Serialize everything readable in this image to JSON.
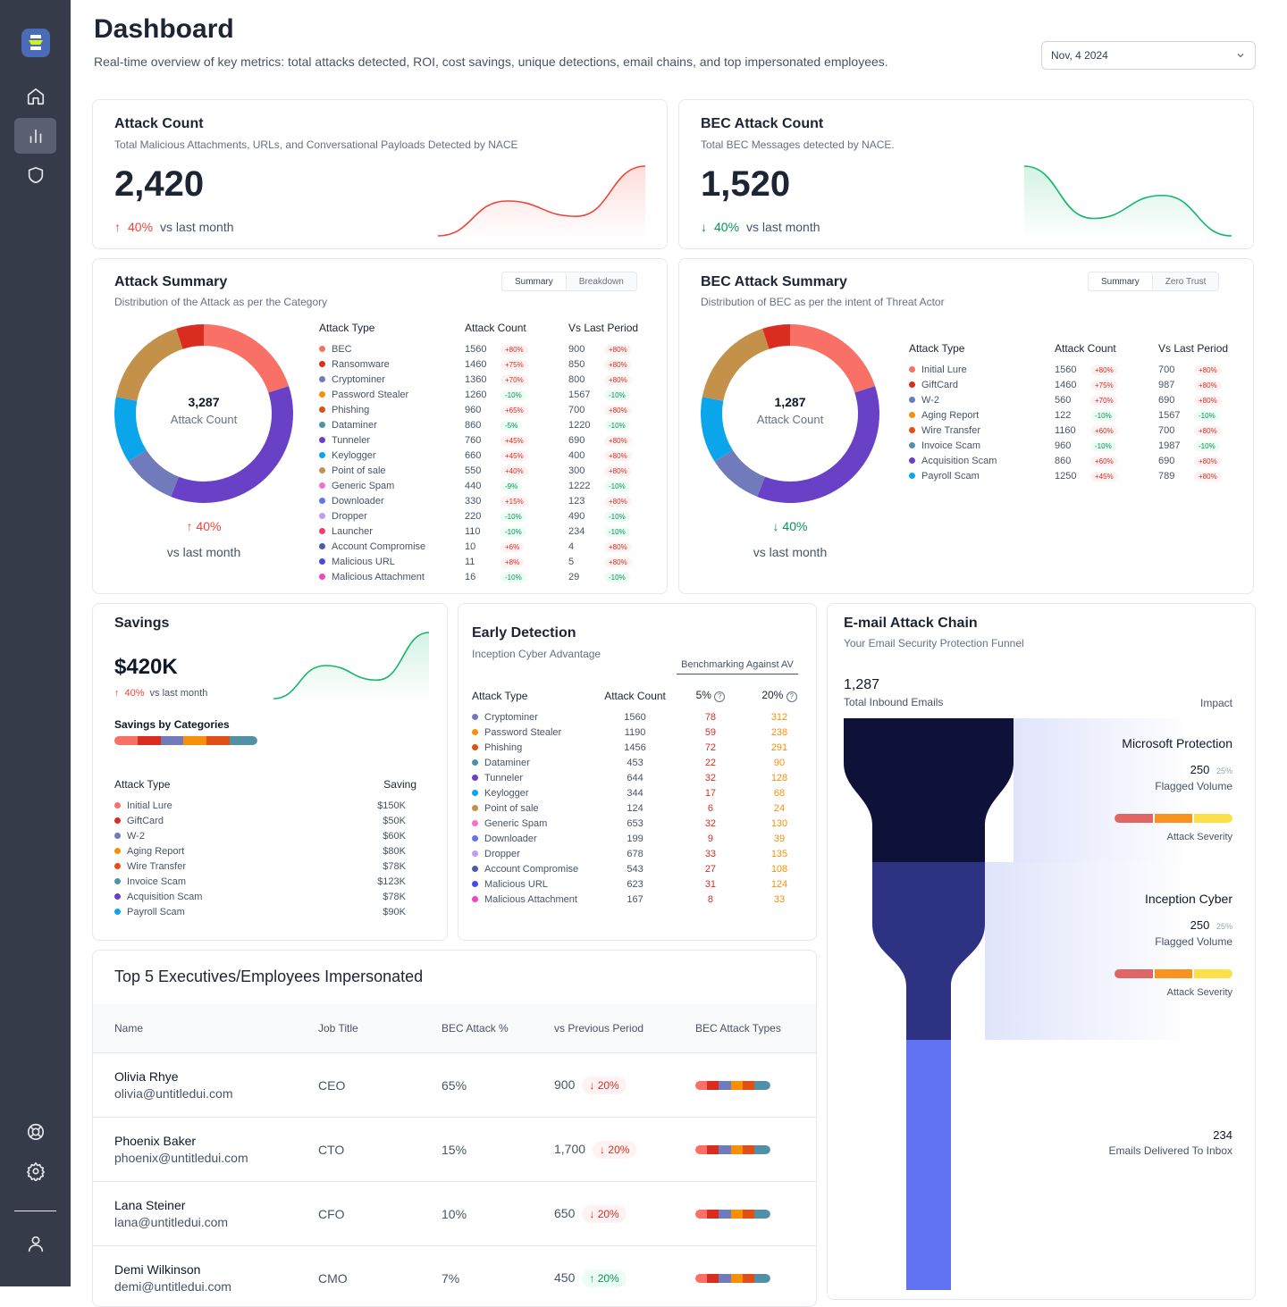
{
  "sidebar": {
    "icons": [
      "home-icon",
      "bar-chart-icon",
      "shield-icon",
      "lifebuoy-icon",
      "settings-icon",
      "user-icon"
    ],
    "active": "bar-chart-icon"
  },
  "header": {
    "title": "Dashboard",
    "subtitle": "Real-time overview of key metrics: total attacks detected, ROI, cost savings, unique detections, email chains, and top impersonated employees.",
    "date": "Nov, 4 2024"
  },
  "attack_count": {
    "title": "Attack Count",
    "subtitle": "Total Malicious Attachments, URLs, and Conversational Payloads Detected by NACE",
    "value": "2,420",
    "trend": "40%",
    "trend_dir": "up",
    "trend_label": "vs last month",
    "spark": [
      0,
      50,
      28,
      100
    ],
    "color": "#f04438"
  },
  "bec_count": {
    "title": "BEC Attack Count",
    "subtitle": "Total BEC Messages detected by NACE.",
    "value": "1,520",
    "trend": "40%",
    "trend_dir": "down",
    "trend_label": "vs last month",
    "spark": [
      100,
      25,
      58,
      0
    ],
    "color": "#12b76a"
  },
  "attack_summary": {
    "title": "Attack Summary",
    "subtitle": "Distribution of the Attack as per the Category",
    "tabs": [
      "Summary",
      "Breakdown"
    ],
    "center_value": "3,287",
    "center_label": "Attack Count",
    "trend": "40%",
    "trend_label": "vs last month",
    "columns": [
      "Attack Type",
      "Attack Count",
      "Vs Last Period"
    ],
    "rows": [
      {
        "name": "BEC",
        "color": "#f97066",
        "count": "1560",
        "cc": "+80%",
        "prev": "900",
        "pc": "+80%"
      },
      {
        "name": "Ransomware",
        "color": "#d92d20",
        "count": "1460",
        "cc": "+75%",
        "prev": "850",
        "pc": "+80%"
      },
      {
        "name": "Cryptominer",
        "color": "#717bbc",
        "count": "1360",
        "cc": "+70%",
        "prev": "800",
        "pc": "+80%"
      },
      {
        "name": "Password Stealer",
        "color": "#f79009",
        "count": "1260",
        "cc": "-10%",
        "prev": "1567",
        "pc": "-10%"
      },
      {
        "name": "Phishing",
        "color": "#e04f16",
        "count": "960",
        "cc": "+65%",
        "prev": "700",
        "pc": "+80%"
      },
      {
        "name": "Dataminer",
        "color": "#5290a8",
        "count": "860",
        "cc": "-5%",
        "prev": "1220",
        "pc": "-10%"
      },
      {
        "name": "Tunneler",
        "color": "#6941c6",
        "count": "760",
        "cc": "+45%",
        "prev": "690",
        "pc": "+80%"
      },
      {
        "name": "Keylogger",
        "color": "#0ba5ec",
        "count": "660",
        "cc": "+45%",
        "prev": "400",
        "pc": "+80%"
      },
      {
        "name": "Point of sale",
        "color": "#c4914b",
        "count": "550",
        "cc": "+40%",
        "prev": "300",
        "pc": "+80%"
      },
      {
        "name": "Generic Spam",
        "color": "#f670c7",
        "count": "440",
        "cc": "-9%",
        "prev": "1222",
        "pc": "-10%"
      },
      {
        "name": "Downloader",
        "color": "#6172f3",
        "count": "330",
        "cc": "+15%",
        "prev": "123",
        "pc": "+80%"
      },
      {
        "name": "Dropper",
        "color": "#c09cf8",
        "count": "220",
        "cc": "-10%",
        "prev": "490",
        "pc": "-10%"
      },
      {
        "name": "Launcher",
        "color": "#f63d68",
        "count": "110",
        "cc": "-10%",
        "prev": "234",
        "pc": "-10%"
      },
      {
        "name": "Account Compromise",
        "color": "#4e5ba6",
        "count": "10",
        "cc": "+6%",
        "prev": "4",
        "pc": "+80%"
      },
      {
        "name": "Malicious URL",
        "color": "#444ce7",
        "count": "11",
        "cc": "+8%",
        "prev": "5",
        "pc": "+80%"
      },
      {
        "name": "Malicious Attachment",
        "color": "#ee46bc",
        "count": "16",
        "cc": "-10%",
        "prev": "29",
        "pc": "-10%"
      }
    ],
    "donut": [
      {
        "color": "#f97066",
        "value": 20
      },
      {
        "color": "#6941c6",
        "value": 36
      },
      {
        "color": "#717bbc",
        "value": 10
      },
      {
        "color": "#0ba5ec",
        "value": 12
      },
      {
        "color": "#c4914b",
        "value": 17
      },
      {
        "color": "#d92d20",
        "value": 5
      }
    ]
  },
  "bec_summary": {
    "title": "BEC Attack Summary",
    "subtitle": "Distribution of BEC as per the intent of Threat Actor",
    "tabs": [
      "Summary",
      "Zero Trust"
    ],
    "center_value": "1,287",
    "center_label": "Attack Count",
    "trend": "40%",
    "trend_label": "vs last month",
    "columns": [
      "Attack Type",
      "Attack Count",
      "Vs Last Period"
    ],
    "rows": [
      {
        "name": "Initial Lure",
        "color": "#f97066",
        "count": "1560",
        "cc": "+80%",
        "prev": "700",
        "pc": "+80%"
      },
      {
        "name": "GiftCard",
        "color": "#d92d20",
        "count": "1460",
        "cc": "+75%",
        "prev": "987",
        "pc": "+80%"
      },
      {
        "name": "W-2",
        "color": "#717bbc",
        "count": "560",
        "cc": "+70%",
        "prev": "690",
        "pc": "+80%"
      },
      {
        "name": "Aging Report",
        "color": "#f79009",
        "count": "122",
        "cc": "-10%",
        "prev": "1567",
        "pc": "-10%"
      },
      {
        "name": "Wire Transfer",
        "color": "#e04f16",
        "count": "1160",
        "cc": "+60%",
        "prev": "700",
        "pc": "+80%"
      },
      {
        "name": "Invoice Scam",
        "color": "#5290a8",
        "count": "960",
        "cc": "-10%",
        "prev": "1987",
        "pc": "-10%"
      },
      {
        "name": "Acquisition Scam",
        "color": "#6941c6",
        "count": "860",
        "cc": "+60%",
        "prev": "690",
        "pc": "+80%"
      },
      {
        "name": "Payroll Scam",
        "color": "#0ba5ec",
        "count": "1250",
        "cc": "+45%",
        "prev": "789",
        "pc": "+80%"
      }
    ],
    "donut": [
      {
        "color": "#f97066",
        "value": 20
      },
      {
        "color": "#6941c6",
        "value": 36
      },
      {
        "color": "#717bbc",
        "value": 10
      },
      {
        "color": "#0ba5ec",
        "value": 12
      },
      {
        "color": "#c4914b",
        "value": 17
      },
      {
        "color": "#d92d20",
        "value": 5
      }
    ]
  },
  "savings": {
    "title": "Savings",
    "value": "$420K",
    "trend": "40%",
    "trend_label": "vs last month",
    "spark": [
      0,
      50,
      28,
      100
    ],
    "categories_title": "Savings by Categories",
    "columns": [
      "Attack Type",
      "Saving"
    ],
    "rows": [
      {
        "name": "Initial Lure",
        "color": "#f97066",
        "saving": "$150K"
      },
      {
        "name": "GiftCard",
        "color": "#d92d20",
        "saving": "$50K"
      },
      {
        "name": "W-2",
        "color": "#717bbc",
        "saving": "$60K"
      },
      {
        "name": "Aging Report",
        "color": "#f79009",
        "saving": "$80K"
      },
      {
        "name": "Wire Transfer",
        "color": "#e04f16",
        "saving": "$78K"
      },
      {
        "name": "Invoice Scam",
        "color": "#5290a8",
        "saving": "$123K"
      },
      {
        "name": "Acquisition Scam",
        "color": "#6941c6",
        "saving": "$78K"
      },
      {
        "name": "Payroll Scam",
        "color": "#0ba5ec",
        "saving": "$90K"
      }
    ],
    "bar_colors": [
      "#f97066",
      "#d92d20",
      "#717bbc",
      "#f79009",
      "#e04f16",
      "#5290a8"
    ]
  },
  "early_detection": {
    "title": "Early Detection",
    "subtitle": "Inception Cyber Advantage",
    "benchmark_label": "Benchmarking Against AV",
    "columns": [
      "Attack Type",
      "Attack Count",
      "5%",
      "20%"
    ],
    "rows": [
      {
        "name": "Cryptominer",
        "color": "#717bbc",
        "count": "1560",
        "p5": "78",
        "p20": "312"
      },
      {
        "name": "Password Stealer",
        "color": "#f79009",
        "count": "1190",
        "p5": "59",
        "p20": "238"
      },
      {
        "name": "Phishing",
        "color": "#e04f16",
        "count": "1456",
        "p5": "72",
        "p20": "291"
      },
      {
        "name": "Dataminer",
        "color": "#5290a8",
        "count": "453",
        "p5": "22",
        "p20": "90"
      },
      {
        "name": "Tunneler",
        "color": "#6941c6",
        "count": "644",
        "p5": "32",
        "p20": "128"
      },
      {
        "name": "Keylogger",
        "color": "#0ba5ec",
        "count": "344",
        "p5": "17",
        "p20": "68"
      },
      {
        "name": "Point of sale",
        "color": "#c4914b",
        "count": "124",
        "p5": "6",
        "p20": "24"
      },
      {
        "name": "Generic Spam",
        "color": "#f670c7",
        "count": "653",
        "p5": "32",
        "p20": "130"
      },
      {
        "name": "Downloader",
        "color": "#6172f3",
        "count": "199",
        "p5": "9",
        "p20": "39"
      },
      {
        "name": "Dropper",
        "color": "#c09cf8",
        "count": "678",
        "p5": "33",
        "p20": "135"
      },
      {
        "name": "Account Compromise",
        "color": "#4e5ba6",
        "count": "543",
        "p5": "27",
        "p20": "108"
      },
      {
        "name": "Malicious URL",
        "color": "#444ce7",
        "count": "623",
        "p5": "31",
        "p20": "124"
      },
      {
        "name": "Malicious Attachment",
        "color": "#ee46bc",
        "count": "167",
        "p5": "8",
        "p20": "33"
      }
    ]
  },
  "email_chain": {
    "title": "E-mail Attack Chain",
    "subtitle": "Your Email Security Protection Funnel",
    "total": "1,287",
    "total_label": "Total Inbound Emails",
    "impact_label": "Impact",
    "stages": [
      {
        "name": "Microsoft Protection",
        "flagged": "250",
        "pct": "25%",
        "flagged_label": "Flagged Volume",
        "severity_label": "Attack Severity"
      },
      {
        "name": "Inception Cyber",
        "flagged": "250",
        "pct": "25%",
        "flagged_label": "Flagged Volume",
        "severity_label": "Attack Severity"
      }
    ],
    "delivered": "234",
    "delivered_label": "Emails Delivered To Inbox",
    "severity_colors": [
      "#e06666",
      "#f7931e",
      "#fde047"
    ]
  },
  "executives": {
    "title": "Top 5 Executives/Employees Impersonated",
    "columns": [
      "Name",
      "Job Title",
      "BEC Attack %",
      "vs Previous Period",
      "BEC Attack Types"
    ],
    "rows": [
      {
        "name": "Olivia Rhye",
        "email": "olivia@untitledui.com",
        "title": "CEO",
        "pct": "65%",
        "prev": "900",
        "change": "20%",
        "dir": "down"
      },
      {
        "name": "Phoenix Baker",
        "email": "phoenix@untitledui.com",
        "title": "CTO",
        "pct": "15%",
        "prev": "1,700",
        "change": "20%",
        "dir": "down"
      },
      {
        "name": "Lana Steiner",
        "email": "lana@untitledui.com",
        "title": "CFO",
        "pct": "10%",
        "prev": "650",
        "change": "20%",
        "dir": "down"
      },
      {
        "name": "Demi Wilkinson",
        "email": "demi@untitledui.com",
        "title": "CMO",
        "pct": "7%",
        "prev": "450",
        "change": "20%",
        "dir": "up"
      }
    ]
  }
}
